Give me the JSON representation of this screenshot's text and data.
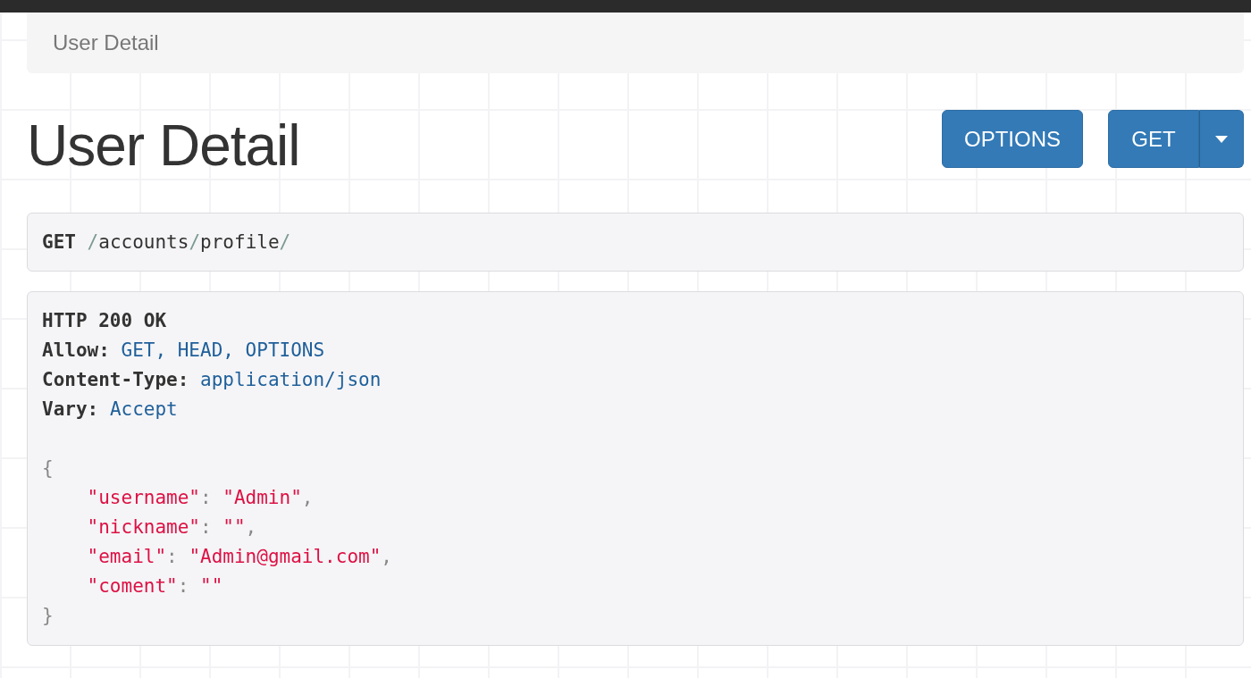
{
  "breadcrumb": {
    "items": [
      {
        "label": "User Detail",
        "selected": true
      }
    ]
  },
  "title": "User Detail",
  "buttons": [
    {
      "label": "OPTIONS",
      "kind": "plain"
    },
    {
      "label": "GET",
      "kind": "split"
    }
  ],
  "request": {
    "method": "GET",
    "path": [
      {
        "text": "/",
        "kind": "sep"
      },
      {
        "text": "accounts",
        "kind": "part"
      },
      {
        "text": "/",
        "kind": "sep"
      },
      {
        "text": "profile",
        "kind": "part"
      },
      {
        "text": "/",
        "kind": "sep"
      }
    ]
  },
  "response": {
    "status": "HTTP 200 OK",
    "headers": [
      {
        "name": "Allow:",
        "value": "GET, HEAD, OPTIONS"
      },
      {
        "name": "Content-Type:",
        "value": "application/json"
      },
      {
        "name": "Vary:",
        "value": "Accept"
      }
    ],
    "body": [
      {
        "indented": false,
        "parts": [
          {
            "text": "{",
            "kind": "punct"
          }
        ]
      },
      {
        "indented": true,
        "parts": [
          {
            "text": "\"username\"",
            "kind": "string"
          },
          {
            "text": ": ",
            "kind": "punct"
          },
          {
            "text": "\"Admin\"",
            "kind": "string"
          },
          {
            "text": ",",
            "kind": "punct"
          }
        ]
      },
      {
        "indented": true,
        "parts": [
          {
            "text": "\"nickname\"",
            "kind": "string"
          },
          {
            "text": ": ",
            "kind": "punct"
          },
          {
            "text": "\"\"",
            "kind": "string"
          },
          {
            "text": ",",
            "kind": "punct"
          }
        ]
      },
      {
        "indented": true,
        "parts": [
          {
            "text": "\"email\"",
            "kind": "string"
          },
          {
            "text": ": ",
            "kind": "punct"
          },
          {
            "text": "\"Admin@gmail.com\"",
            "kind": "string"
          },
          {
            "text": ",",
            "kind": "punct"
          }
        ]
      },
      {
        "indented": true,
        "parts": [
          {
            "text": "\"coment\"",
            "kind": "string"
          },
          {
            "text": ": ",
            "kind": "punct"
          },
          {
            "text": "\"\"",
            "kind": "string"
          }
        ]
      },
      {
        "indented": false,
        "parts": [
          {
            "text": "}",
            "kind": "punct"
          }
        ]
      }
    ]
  }
}
